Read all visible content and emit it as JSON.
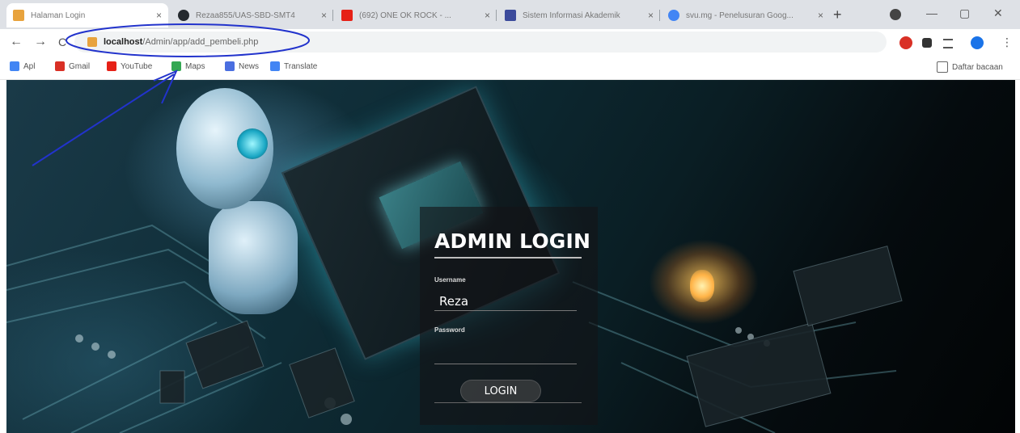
{
  "tabs": [
    {
      "title": "Halaman Login",
      "favicon_color": "#e8a33d",
      "active": true
    },
    {
      "title": "Rezaa855/UAS-SBD-SMT4",
      "favicon_color": "#24292e",
      "active": false
    },
    {
      "title": "(692) ONE OK ROCK - ...",
      "favicon_color": "#e62117",
      "active": false
    },
    {
      "title": "Sistem Informasi Akademik",
      "favicon_color": "#3b4a9b",
      "active": false
    },
    {
      "title": "svu.mg - Penelusuran Goog...",
      "favicon_color": "#4285f4",
      "active": false
    }
  ],
  "tab_close_glyph": "×",
  "new_tab_glyph": "+",
  "window_controls": {
    "minimize": "—",
    "restore": "▢",
    "close": "✕"
  },
  "address": {
    "host": "localhost",
    "path": "/Admin/app/add_pembeli.php"
  },
  "nav_glyphs": {
    "back": "←",
    "forward": "→",
    "reload": "C"
  },
  "bookmarks": [
    {
      "label": "Apl",
      "icon": "apps-grid-icon",
      "color": "#4285f4"
    },
    {
      "label": "Gmail",
      "icon": "gmail-icon",
      "color": "#d93025"
    },
    {
      "label": "YouTube",
      "icon": "youtube-icon",
      "color": "#e62117"
    },
    {
      "label": "Maps",
      "icon": "maps-icon",
      "color": "#34a853"
    },
    {
      "label": "News",
      "icon": "news-icon",
      "color": "#4a6ee0"
    },
    {
      "label": "Translate",
      "icon": "translate-icon",
      "color": "#4285f4"
    }
  ],
  "reading_list": "Daftar bacaan",
  "login": {
    "title": "ADMIN LOGIN",
    "username_label": "Username",
    "username_value": "Reza",
    "password_label": "Password",
    "password_value": "",
    "button": "LOGIN"
  },
  "colors": {
    "annotation": "#2233cc"
  }
}
